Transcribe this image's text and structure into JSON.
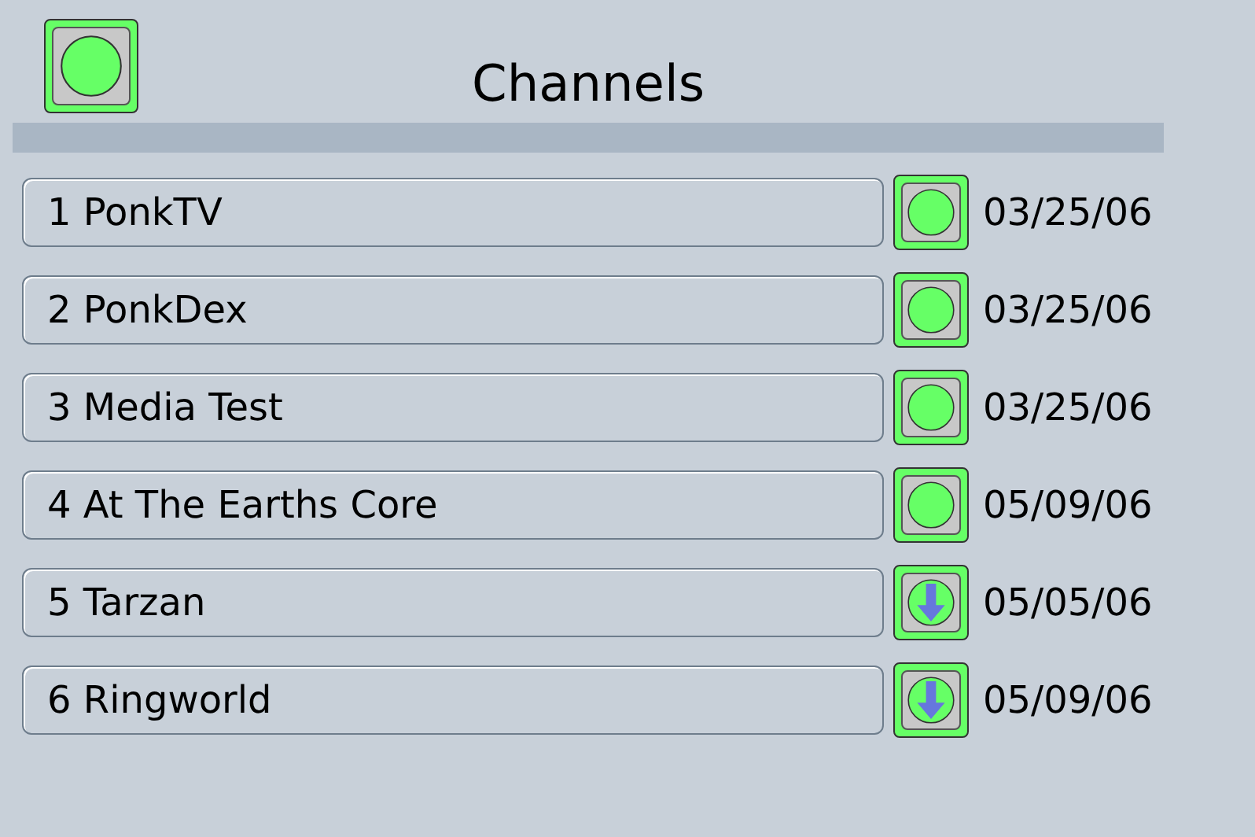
{
  "header": {
    "title": "Channels"
  },
  "channels": [
    {
      "label": "1 PonkTV",
      "kind": "ready",
      "date": "03/25/06"
    },
    {
      "label": "2 PonkDex",
      "kind": "ready",
      "date": "03/25/06"
    },
    {
      "label": "3 Media Test",
      "kind": "ready",
      "date": "03/25/06"
    },
    {
      "label": "4 At The Earths Core",
      "kind": "ready",
      "date": "05/09/06"
    },
    {
      "label": "5 Tarzan",
      "kind": "download",
      "date": "05/05/06"
    },
    {
      "label": "6 Ringworld",
      "kind": "download",
      "date": "05/09/06"
    }
  ]
}
